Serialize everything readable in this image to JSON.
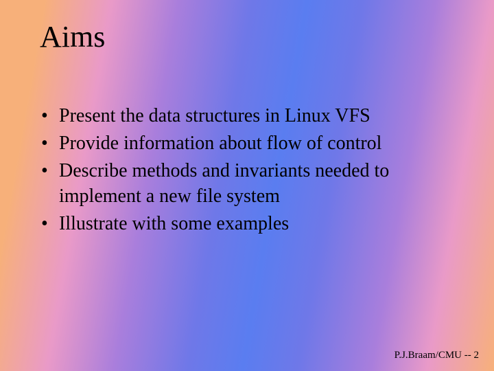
{
  "title": "Aims",
  "bullets": [
    "Present the data structures in Linux VFS",
    "Provide information about flow of control",
    "Describe methods and invariants needed to implement a new file system",
    "Illustrate with some examples"
  ],
  "footer": "P.J.Braam/CMU -- 2"
}
